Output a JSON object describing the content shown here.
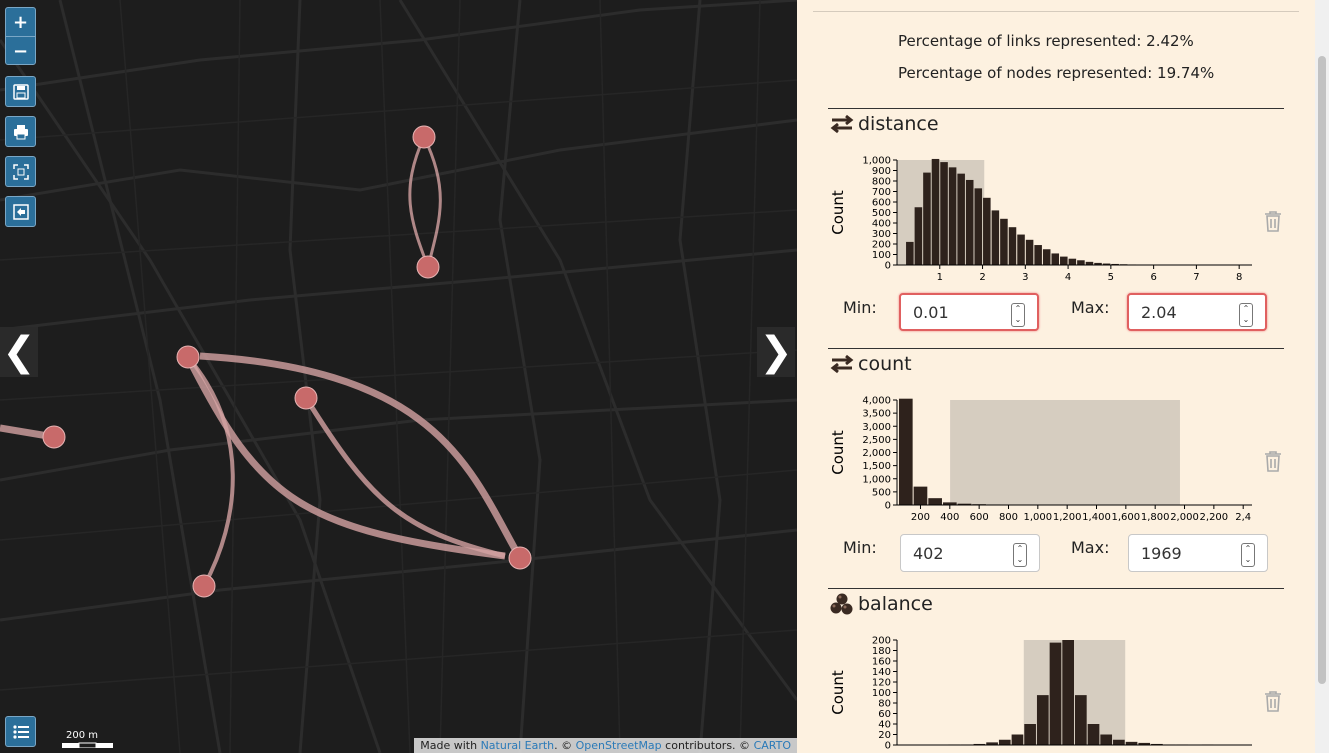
{
  "map": {
    "zoom_in_label": "+",
    "zoom_out_label": "−",
    "scale_label": "200 m",
    "attribution": {
      "prefix": "Made with ",
      "natural_earth": "Natural Earth",
      "sep1": ". © ",
      "osm": "OpenStreetMap",
      "sep2": " contributors. © ",
      "carto": "CARTO"
    },
    "colors": {
      "link": "#d4a2a2",
      "node": "#c86a6a",
      "panel_bg": "#fdf1e0",
      "button": "#2b6f9a"
    }
  },
  "panel": {
    "links_pct": "Percentage of links represented: 2.42%",
    "nodes_pct": "Percentage of nodes represented: 19.74%",
    "filters": [
      {
        "title": "distance",
        "icon": "swap-arrows-icon",
        "ylabel": "Count",
        "min_label": "Min:",
        "max_label": "Max:",
        "min_value": "0.01",
        "max_value": "2.04"
      },
      {
        "title": "count",
        "icon": "swap-arrows-icon",
        "ylabel": "Count",
        "min_label": "Min:",
        "max_label": "Max:",
        "min_value": "402",
        "max_value": "1969"
      },
      {
        "title": "balance",
        "icon": "categories-icon",
        "ylabel": "Count"
      }
    ]
  },
  "chart_data": [
    {
      "type": "bar",
      "title": "distance",
      "ylabel": "Count",
      "xlim": [
        0,
        8.3
      ],
      "ylim": [
        0,
        1000
      ],
      "yticks": [
        "0",
        "100",
        "200",
        "300",
        "400",
        "500",
        "600",
        "700",
        "800",
        "900",
        "1,000"
      ],
      "xticks": [
        "1",
        "2",
        "3",
        "4",
        "5",
        "6",
        "7",
        "8"
      ],
      "bin_width": 0.2,
      "bins_start": 0.2,
      "values": [
        220,
        550,
        880,
        1010,
        980,
        930,
        870,
        810,
        730,
        640,
        520,
        440,
        360,
        290,
        240,
        190,
        150,
        110,
        80,
        60,
        45,
        30,
        20,
        14,
        10,
        7,
        5,
        3,
        2,
        1
      ],
      "selection": [
        0.01,
        2.04
      ]
    },
    {
      "type": "bar",
      "title": "count",
      "ylabel": "Count",
      "xlim": [
        40,
        2460
      ],
      "ylim": [
        0,
        4000
      ],
      "yticks": [
        "0",
        "500",
        "1,000",
        "1,500",
        "2,000",
        "2,500",
        "3,000",
        "3,500",
        "4,000"
      ],
      "xticks": [
        "200",
        "400",
        "600",
        "800",
        "1,000",
        "1,200",
        "1,400",
        "1,600",
        "1,800",
        "2,000",
        "2,200",
        "2,4"
      ],
      "bin_width": 100,
      "bins_start": 50,
      "values": [
        4050,
        700,
        260,
        100,
        50,
        30,
        20,
        14,
        10,
        8,
        6,
        5,
        4,
        3,
        3,
        2,
        2,
        2,
        2,
        1,
        1,
        1,
        1,
        1
      ],
      "selection": [
        402,
        1969
      ]
    },
    {
      "type": "bar",
      "title": "balance",
      "ylabel": "Count",
      "xlim": [
        -35,
        35
      ],
      "ylim": [
        0,
        200
      ],
      "yticks": [
        "0",
        "20",
        "40",
        "60",
        "80",
        "100",
        "120",
        "140",
        "160",
        "180",
        "200"
      ],
      "bin_width": 2.5,
      "bins_start": -35,
      "values": [
        0,
        0,
        0,
        0,
        1,
        1,
        2,
        5,
        10,
        20,
        40,
        95,
        195,
        200,
        95,
        40,
        20,
        10,
        6,
        4,
        2,
        1,
        1,
        0,
        1,
        0,
        0,
        0
      ],
      "selection": [
        -10,
        10
      ]
    }
  ]
}
